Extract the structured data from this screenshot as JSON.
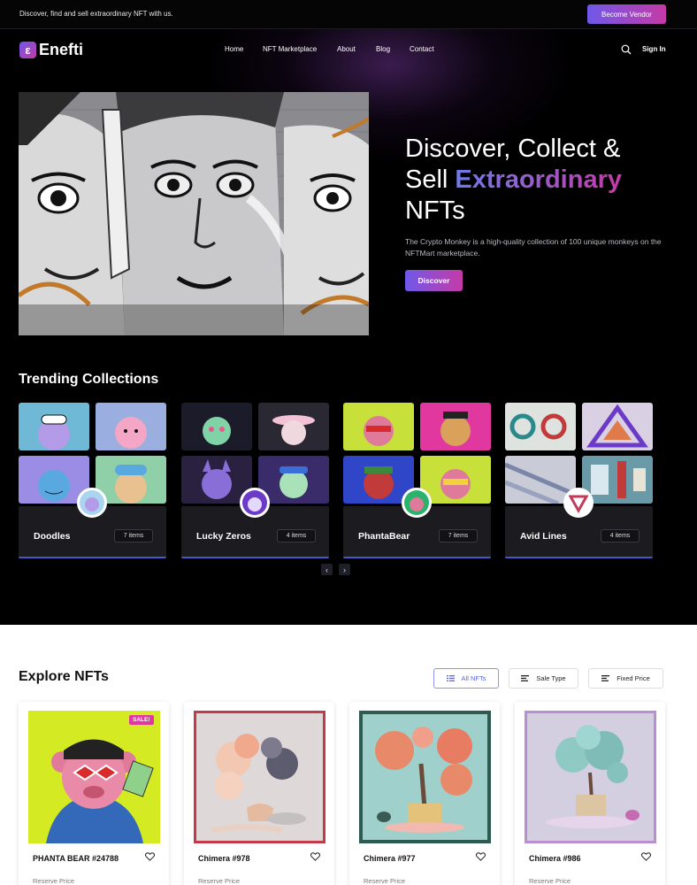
{
  "topbar": {
    "text": "Discover, find and sell extraordinary NFT with us.",
    "vendor_button": "Become Vendor"
  },
  "brand": {
    "mark": "ε",
    "name": "Enefti"
  },
  "nav": {
    "items": [
      "Home",
      "NFT Marketplace",
      "About",
      "Blog",
      "Contact"
    ],
    "sign_in": "Sign In",
    "search_icon": "search-icon"
  },
  "hero": {
    "title_line1": "Discover, Collect &",
    "title_sell": "Sell ",
    "title_highlight": "Extraordinary",
    "title_line3": "NFTs",
    "description": "The Crypto Monkey is a high-quality collection of 100 unique monkeys on the NFTMart marketplace.",
    "cta": "Discover"
  },
  "trending": {
    "title": "Trending Collections",
    "collections": [
      {
        "name": "Doodles",
        "count": "7 items"
      },
      {
        "name": "Lucky Zeros",
        "count": "4 items"
      },
      {
        "name": "PhantaBear",
        "count": "7 items"
      },
      {
        "name": "Avid Lines",
        "count": "4 items"
      }
    ],
    "prev": "‹",
    "next": "›"
  },
  "explore": {
    "title": "Explore NFTs",
    "filters": [
      "All NFTs",
      "Sale Type",
      "Fixed Price"
    ],
    "items": [
      {
        "title": "PHANTA BEAR #24788",
        "label": "Reserve Price",
        "badge": "SALE!"
      },
      {
        "title": "Chimera #978",
        "label": "Reserve Price"
      },
      {
        "title": "Chimera #977",
        "label": "Reserve Price"
      },
      {
        "title": "Chimera #986",
        "label": "Reserve Price"
      }
    ]
  },
  "colors": {
    "accent_start": "#6f58e8",
    "accent_end": "#c53aa8",
    "dark_bg": "#000000"
  }
}
